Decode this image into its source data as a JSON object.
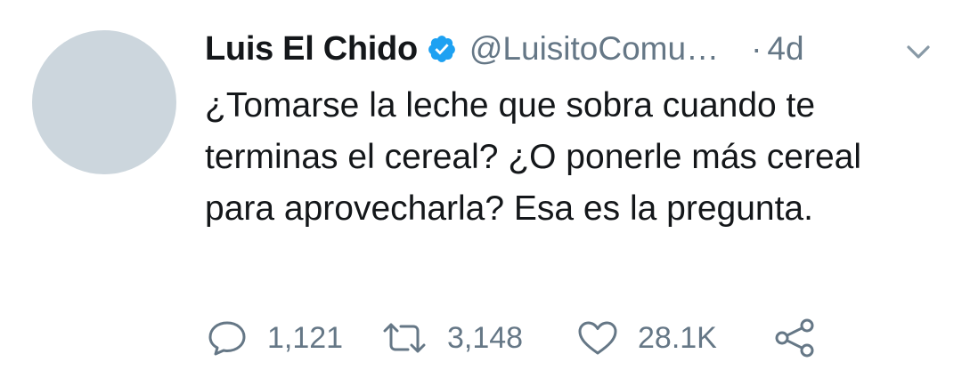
{
  "tweet": {
    "author_name": "Luis El Chido",
    "author_handle": "@LuisitoComu…",
    "separator": "·",
    "time": "4d",
    "text": "¿Tomarse la leche que sobra cuando te terminas el cereal? ¿O ponerle más cereal para aprovecharla? Esa es la pregunta.",
    "verified": true
  },
  "actions": {
    "reply_count": "1,121",
    "retweet_count": "3,148",
    "like_count": "28.1K"
  },
  "icons": {
    "verified": "verified-badge-icon",
    "caret": "chevron-down-icon",
    "reply": "reply-bubble-icon",
    "retweet": "retweet-icon",
    "like": "heart-icon",
    "share": "share-icon"
  },
  "colors": {
    "verified_blue": "#1da1f2",
    "muted_text": "#657786",
    "avatar_placeholder": "#ccd6dd"
  }
}
